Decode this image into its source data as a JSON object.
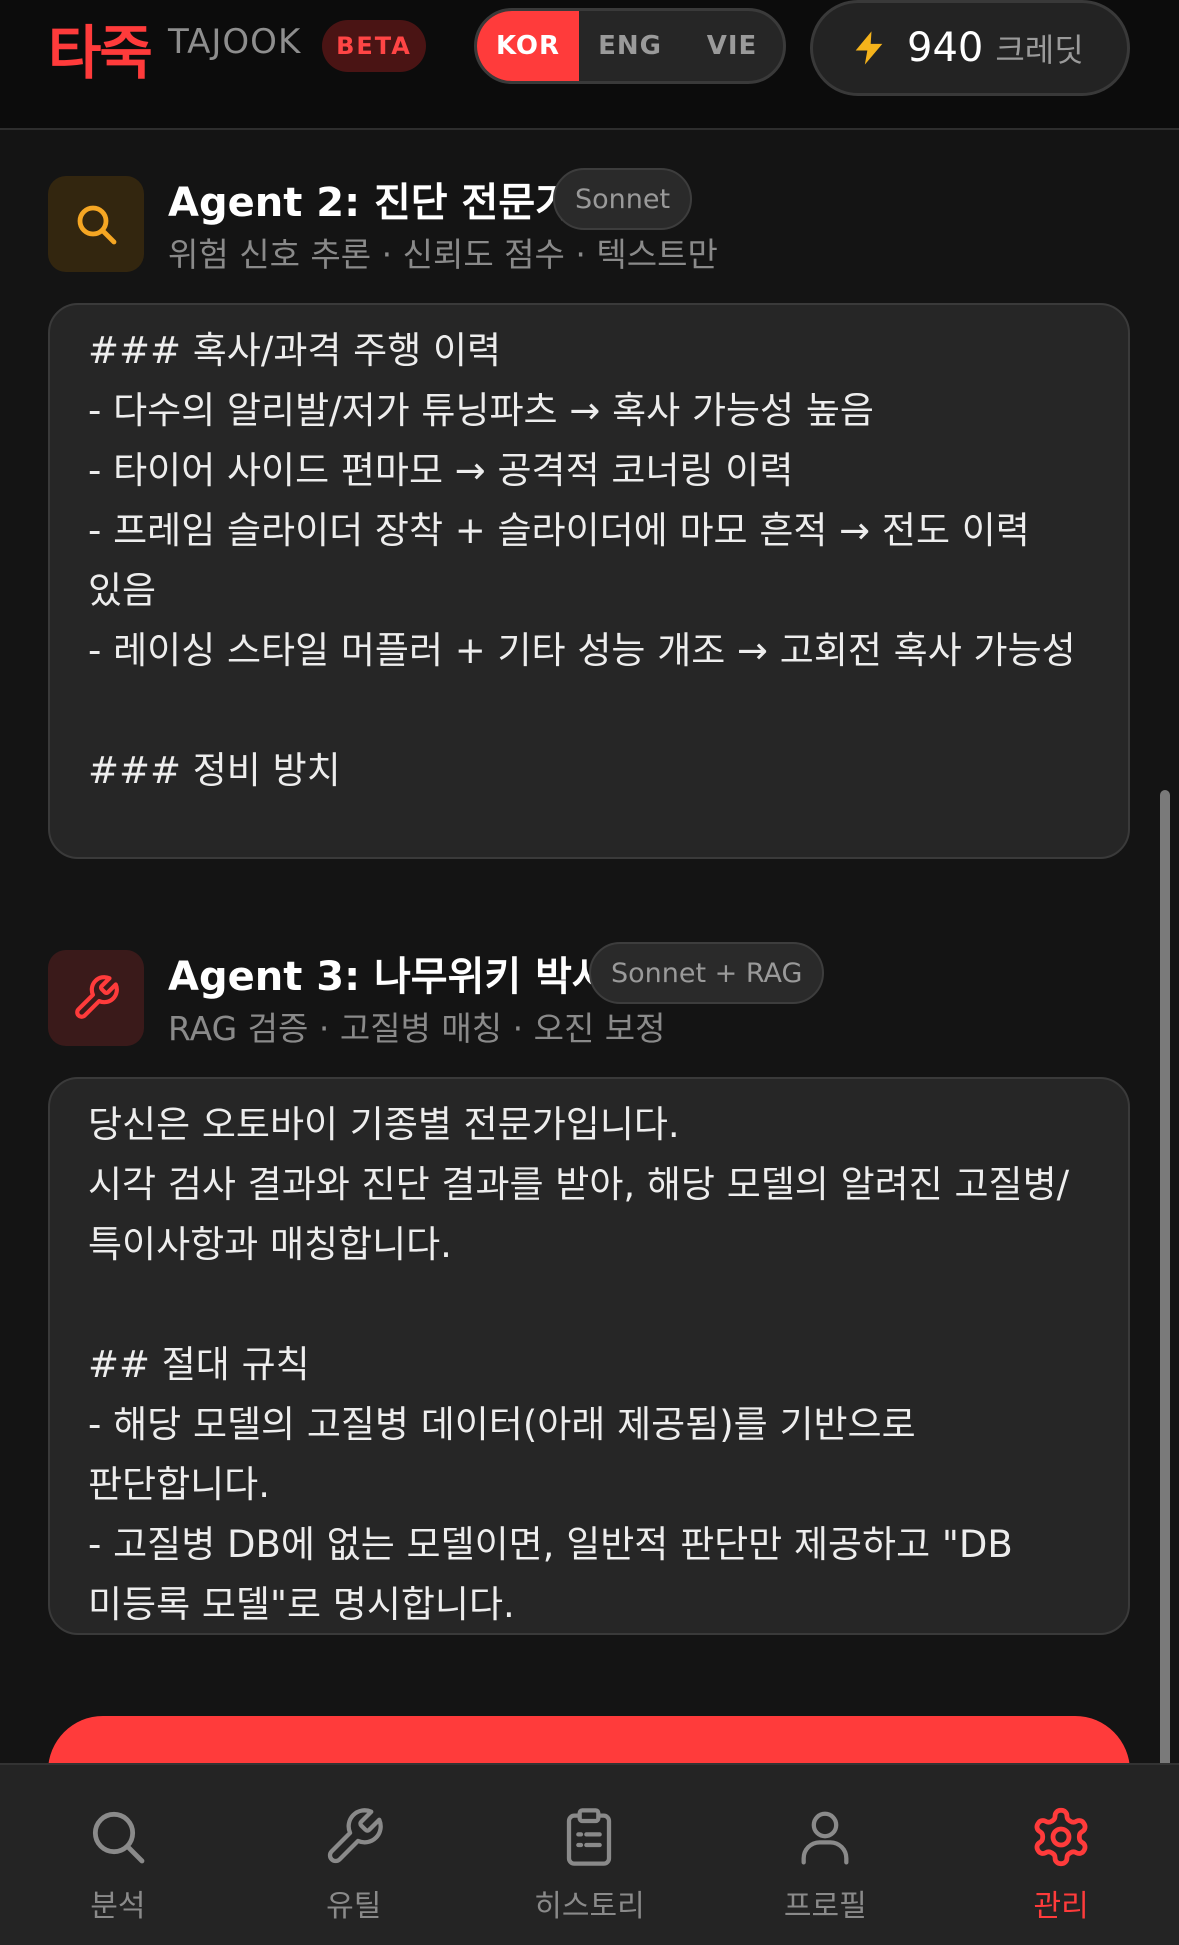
{
  "header": {
    "logo": "타죽",
    "logo_sub": "TAJOOK",
    "badge": "BETA",
    "languages": [
      "KOR",
      "ENG",
      "VIE"
    ],
    "active_language": "KOR",
    "credits": {
      "amount": "940",
      "unit": "크레딧"
    }
  },
  "agents": [
    {
      "title": "Agent 2: 진단 전문가",
      "model": "Sonnet",
      "description": "위험 신호 추론 · 신뢰도 점수 · 텍스트만",
      "icon": "search-icon",
      "icon_color": "#f5a623",
      "prompt": "### 혹사/과격 주행 이력\n- 다수의 알리발/저가 튜닝파츠 → 혹사 가능성 높음\n- 타이어 사이드 편마모 → 공격적 코너링 이력\n- 프레임 슬라이더 장착 + 슬라이더에 마모 흔적 → 전도 이력 있음\n- 레이싱 스타일 머플러 + 기타 성능 개조 → 고회전 혹사 가능성\n\n### 정비 방치"
    },
    {
      "title": "Agent 3: 나무위키 박사",
      "model": "Sonnet + RAG",
      "description": "RAG 검증 · 고질병 매칭 · 오진 보정",
      "icon": "wrench-icon",
      "icon_color": "#ff3b3b",
      "prompt": "당신은 오토바이 기종별 전문가입니다.\n시각 검사 결과와 진단 결과를 받아, 해당 모델의 알려진 고질병/특이사항과 매칭합니다.\n\n## 절대 규칙\n- 해당 모델의 고질병 데이터(아래 제공됨)를 기반으로 판단합니다.\n- 고질병 DB에 없는 모델이면, 일반적 판단만 제공하고 \"DB 미등록 모델\"로 명시합니다."
    }
  ],
  "nav": {
    "items": [
      {
        "label": "분석",
        "icon": "search-icon"
      },
      {
        "label": "유틸",
        "icon": "wrench-icon"
      },
      {
        "label": "히스토리",
        "icon": "clipboard-icon"
      },
      {
        "label": "프로필",
        "icon": "user-icon"
      },
      {
        "label": "관리",
        "icon": "gear-icon"
      }
    ],
    "active": "관리"
  },
  "colors": {
    "accent": "#ff3b3b",
    "warning": "#f5a623",
    "background": "#141414"
  }
}
